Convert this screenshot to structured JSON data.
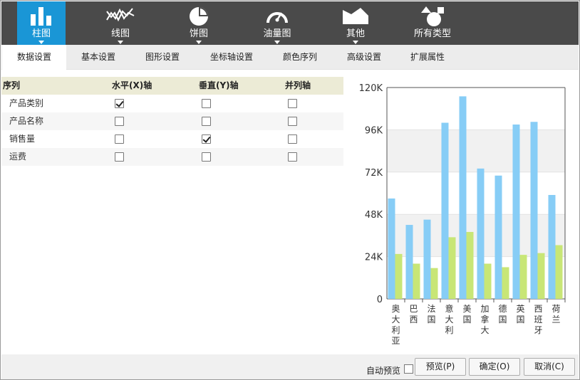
{
  "chart_types": [
    {
      "label": "柱图",
      "icon": "bar-chart-icon",
      "active": true
    },
    {
      "label": "线图",
      "icon": "line-chart-icon",
      "active": false
    },
    {
      "label": "饼图",
      "icon": "pie-chart-icon",
      "active": false
    },
    {
      "label": "油量图",
      "icon": "gauge-icon",
      "active": false
    },
    {
      "label": "其他",
      "icon": "area-chart-icon",
      "active": false
    },
    {
      "label": "所有类型",
      "icon": "shapes-icon",
      "active": false
    }
  ],
  "tabs": [
    {
      "label": "数据设置",
      "active": true
    },
    {
      "label": "基本设置",
      "active": false
    },
    {
      "label": "图形设置",
      "active": false
    },
    {
      "label": "坐标轴设置",
      "active": false
    },
    {
      "label": "颜色序列",
      "active": false
    },
    {
      "label": "高级设置",
      "active": false
    },
    {
      "label": "扩展属性",
      "active": false
    }
  ],
  "series_table": {
    "headers": [
      "序列",
      "水平(X)轴",
      "垂直(Y)轴",
      "并列轴"
    ],
    "rows": [
      {
        "label": "产品类别",
        "x_axis": true,
        "y_axis": false,
        "parallel": false
      },
      {
        "label": "产品名称",
        "x_axis": false,
        "y_axis": false,
        "parallel": false
      },
      {
        "label": "销售量",
        "x_axis": false,
        "y_axis": true,
        "parallel": false
      },
      {
        "label": "运费",
        "x_axis": false,
        "y_axis": false,
        "parallel": false
      }
    ]
  },
  "chart_data": {
    "type": "bar",
    "categories": [
      "奥大利亚",
      "巴西",
      "法国",
      "意大利",
      "美国",
      "加拿大",
      "德国",
      "英国",
      "西班牙",
      "荷兰"
    ],
    "series": [
      {
        "color": "#87cdf6",
        "values": [
          57000,
          42000,
          45000,
          100000,
          115000,
          74000,
          70000,
          99000,
          100500,
          59000
        ]
      },
      {
        "color": "#c8e676",
        "values": [
          25500,
          20000,
          17500,
          35000,
          38000,
          20000,
          18000,
          25000,
          26000,
          30500
        ]
      }
    ],
    "yticks": [
      "0",
      "24K",
      "48K",
      "72K",
      "96K",
      "120K"
    ],
    "ylim": [
      0,
      120000
    ],
    "grid": "alternating bands"
  },
  "footer": {
    "auto_preview_label": "自动预览",
    "auto_preview_checked": false,
    "preview_label": "预览(P)",
    "ok_label": "确定(O)",
    "cancel_label": "取消(C)"
  }
}
